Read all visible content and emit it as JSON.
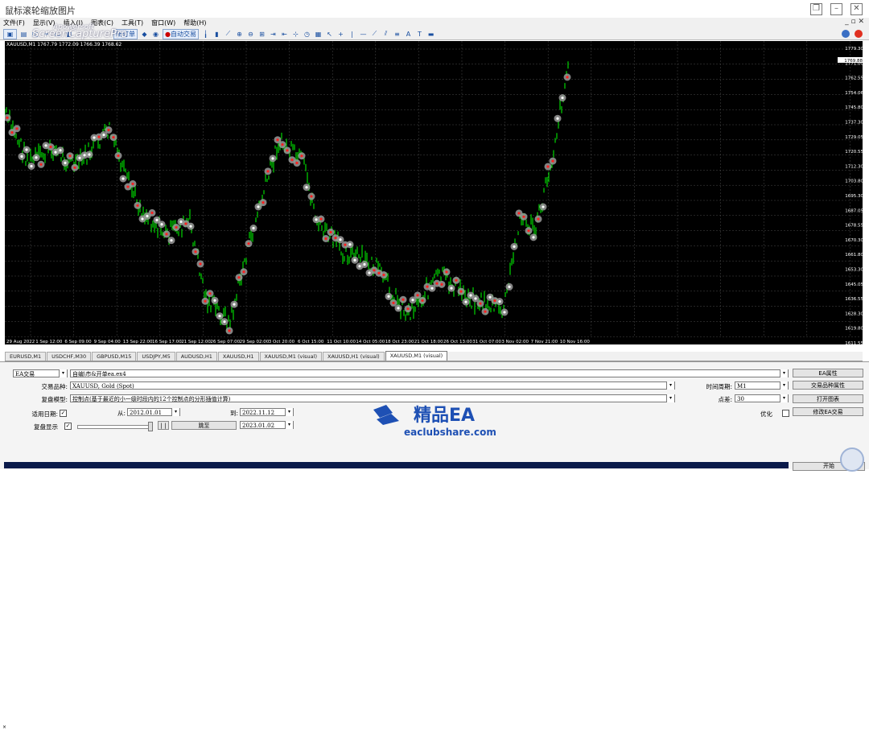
{
  "window": {
    "title": "鼠标滚轮缩放图片",
    "controls": [
      "❐",
      "–",
      "✕"
    ]
  },
  "menu": {
    "items": [
      "文件(F)",
      "显示(V)",
      "插入(I)",
      "图表(C)",
      "工具(T)",
      "窗口(W)",
      "帮助(H)"
    ],
    "window_ctrl": "_ ▫ ✕"
  },
  "toolbar": {
    "new_order": "新订单",
    "auto_trade": "自动交易",
    "watermark_main": "ScreenCapturePro",
    "watermark_small": "Apowersoft"
  },
  "chart": {
    "info": "XAUUSD,M1 1767.79 1772.09 1766.39 1768.62",
    "current_price": "1769.88",
    "price_labels": [
      "1779.30",
      "1771.00",
      "1762.55",
      "1754.06",
      "1745.80",
      "1737.30",
      "1729.05",
      "1720.55",
      "1712.30",
      "1703.80",
      "1695.30",
      "1687.05",
      "1678.55",
      "1670.30",
      "1661.80",
      "1653.30",
      "1645.05",
      "1636.55",
      "1628.30",
      "1619.80",
      "1611.55"
    ],
    "time_labels": [
      "29 Aug 2022",
      "1 Sep 12:00",
      "6 Sep 09:00",
      "9 Sep 04:00",
      "13 Sep 22:00",
      "16 Sep 17:00",
      "21 Sep 12:00",
      "26 Sep 07:00",
      "29 Sep 02:00",
      "3 Oct 20:00",
      "6 Oct 15:00",
      "11 Oct 10:00",
      "14 Oct 05:00",
      "18 Oct 23:00",
      "21 Oct 18:00",
      "26 Oct 13:00",
      "31 Oct 07:00",
      "3 Nov 02:00",
      "7 Nov 21:00",
      "10 Nov 16:00"
    ],
    "colors": {
      "background": "#000000",
      "grid": "#4a4a4a",
      "candle": "#00ff00",
      "marker_halo": "#9a9a9a",
      "marker_buy": "#ffffff",
      "marker_sell": "#ff2020"
    }
  },
  "tabs": [
    {
      "label": "EURUSD,M1",
      "active": false
    },
    {
      "label": "USDCHF,M30",
      "active": false
    },
    {
      "label": "GBPUSD,M15",
      "active": false
    },
    {
      "label": "USDJPY,M5",
      "active": false
    },
    {
      "label": "AUDUSD,H1",
      "active": false
    },
    {
      "label": "XAUUSD,H1",
      "active": false
    },
    {
      "label": "XAUUSD,M1 (visual)",
      "active": false
    },
    {
      "label": "XAUUSD,H1 (visual)",
      "active": false
    },
    {
      "label": "XAUUSD,M1 (visual)",
      "active": true
    }
  ],
  "tester": {
    "mode": "EA交易",
    "ea_path": "自编\\市&开单ea.ex4",
    "symbol_label": "交易品种:",
    "symbol": "XAUUSD, Gold (Spot)",
    "model_label": "复盘模型:",
    "model": "控制点(基于最近的小一级时段内的12个控制点的分形插值计算)",
    "use_date_label": "适用日期:",
    "use_date_checked": "✓",
    "from_label": "从:",
    "from_date": "2012.01.01",
    "to_label": "到:",
    "to_date": "2022.11.12",
    "visual_label": "复盘显示",
    "visual_checked": "✓",
    "pause": "| |",
    "skip_btn": "跳至",
    "skip_date": "2023.01.02",
    "period_label": "时间周期:",
    "period": "M1",
    "spread_label": "点差:",
    "spread": "30",
    "optimize_label": "优化",
    "buttons": {
      "ea_props": "EA属性",
      "symbol_props": "交易品种属性",
      "open_chart": "打开图表",
      "modify_ea": "修改EA交易",
      "start": "开始"
    }
  },
  "brand": {
    "name": "精品EA",
    "url": "eaclubshare.com"
  }
}
